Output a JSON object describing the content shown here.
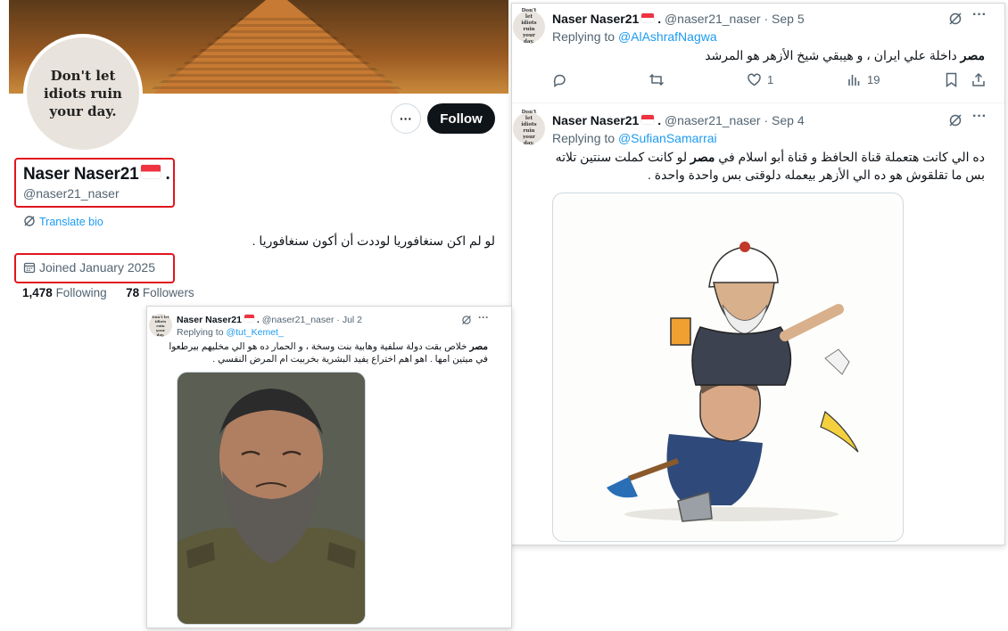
{
  "profile": {
    "avatar_text": "Don't let idiots ruin your day.",
    "display_name": "Naser Naser21",
    "display_suffix": ".",
    "handle": "@naser21_naser",
    "more_label": "···",
    "follow_label": "Follow",
    "translate_label": "Translate bio",
    "bio": "لو لم اكن سنغافوريا لوددت أن أكون سنغافوريا .",
    "joined": "Joined January 2025",
    "following_count": "1,478",
    "following_label": "Following",
    "followers_count": "78",
    "followers_label": "Followers"
  },
  "tweets": [
    {
      "avatar_text": "Don't let idiots ruin your day.",
      "name": "Naser Naser21",
      "suffix": ".",
      "handle": "@naser21_naser",
      "date": "Sep 5",
      "replying_prefix": "Replying to",
      "replying_to": "@AlAshrafNagwa",
      "text_bold": "مصر",
      "text": "داخلة علي ايران ، و هيبقي شيخ الأزهر  هو المرشد",
      "replies": "",
      "retweets": "",
      "likes": "1",
      "views": "19"
    },
    {
      "avatar_text": "Don't let idiots ruin your day.",
      "name": "Naser Naser21",
      "suffix": ".",
      "handle": "@naser21_naser",
      "date": "Sep 4",
      "replying_prefix": "Replying to",
      "replying_to": "@SufianSamarrai",
      "line1_a": "ده الي كانت هتعملة قناة الحافظ و قناة أبو اسلام في",
      "line1_bold": "مصر",
      "line1_b": "لو كانت كملت سنتين تلاته",
      "line2": "بس ما تقلقوش هو ده الي الأزهر بيعمله دلوقتى بس واحدة واحدة ."
    },
    {
      "avatar_text": "Don't let idiots ruin your day.",
      "name": "Naser Naser21",
      "suffix": ".",
      "handle": "@naser21_naser",
      "date": "Jul 2",
      "replying_prefix": "Replying to",
      "replying_to": "@tut_Kemet_",
      "line1_bold": "مصر",
      "line1": "خلاص بقت دولة سلفية وهابية بنت وسخة ، و الحمار ده هو الي مخليهم بيرطعوا",
      "line2": "في ميتين امها . اهو اهم اختراع يفيد البشرية بخربيت ام المرض النفسي ."
    }
  ],
  "colors": {
    "accent": "#1d9bf0",
    "highlight_box": "#e0161e",
    "follow_button": "#0f1419"
  }
}
